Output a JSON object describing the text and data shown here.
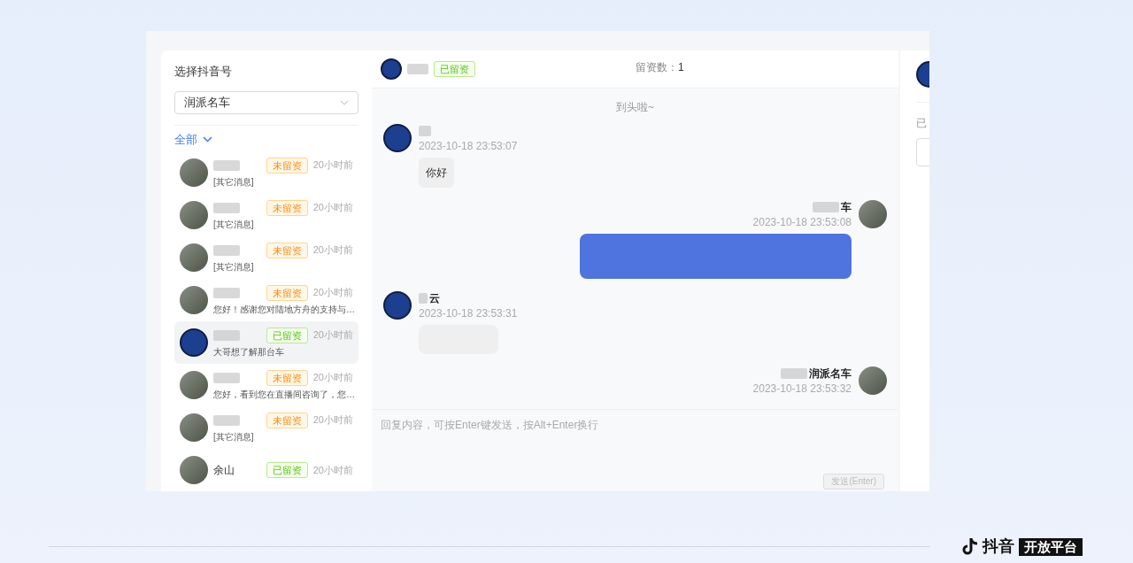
{
  "sidebar": {
    "title": "选择抖音号",
    "account_select": {
      "value": "润派名车"
    },
    "filter": {
      "label": "全部"
    },
    "contacts": [
      {
        "kind": "photo",
        "badge": "未留资",
        "lead_left": false,
        "time": "20小时前",
        "preview": "[其它消息]",
        "selected": false
      },
      {
        "kind": "photo",
        "badge": "未留资",
        "lead_left": false,
        "time": "20小时前",
        "preview": "[其它消息]",
        "selected": false
      },
      {
        "kind": "photo",
        "badge": "未留资",
        "lead_left": false,
        "time": "20小时前",
        "preview": "[其它消息]",
        "selected": false
      },
      {
        "kind": "photo",
        "badge": "未留资",
        "lead_left": false,
        "time": "20小时前",
        "preview": "您好！感谢您对陆地方舟的支持与…",
        "selected": false
      },
      {
        "kind": "logo",
        "badge": "已留资",
        "lead_left": true,
        "time": "20小时前",
        "preview": "大哥想了解那台车",
        "selected": true
      },
      {
        "kind": "photo",
        "badge": "未留资",
        "lead_left": false,
        "time": "20小时前",
        "preview": "您好，看到您在直播间咨询了，您…",
        "selected": false
      },
      {
        "kind": "photo",
        "badge": "未留资",
        "lead_left": false,
        "time": "20小时前",
        "preview": "[其它消息]",
        "selected": false
      },
      {
        "kind": "photo",
        "name": "余山",
        "badge": "已留资",
        "lead_left": true,
        "time": "20小时前",
        "selected": false
      }
    ]
  },
  "chat": {
    "header": {
      "badge": "已留资",
      "lead_left": true,
      "lead_count_label": "留资数：",
      "lead_count": "1"
    },
    "top_notice": "到头啦~",
    "messages": [
      {
        "kind": "incoming",
        "time": "2023-10-18 23:53:07",
        "text": "你好"
      },
      {
        "kind": "outgoing",
        "name": "车",
        "time": "2023-10-18 23:53:08",
        "blurred": true
      },
      {
        "kind": "incoming",
        "name": "云",
        "time": "2023-10-18 23:53:31",
        "blurred": true
      },
      {
        "kind": "outgoing",
        "name": "润派名车",
        "time": "2023-10-18 23:53:32"
      }
    ],
    "input": {
      "placeholder": "回复内容，可按Enter键发送，按Alt+Enter换行"
    },
    "send_button": {
      "label": "发送(Enter)",
      "disabled": true
    }
  },
  "right_panel": {
    "label": "已"
  },
  "footer": {
    "brand": "抖音",
    "tag": "开放平台"
  }
}
